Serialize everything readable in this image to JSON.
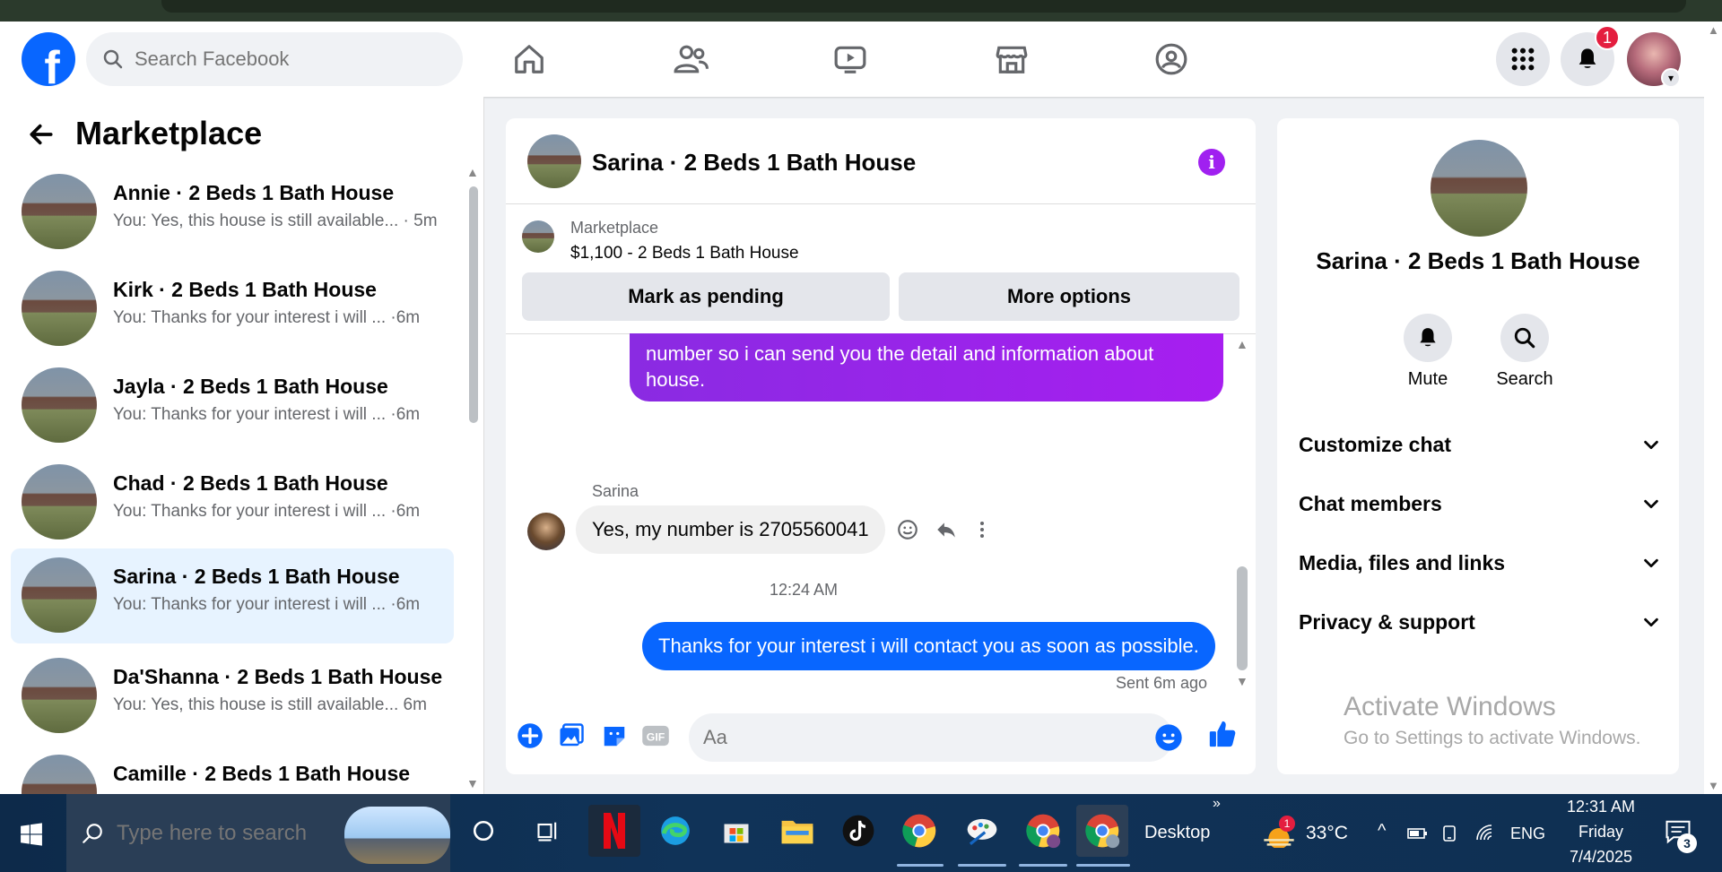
{
  "header": {
    "search_placeholder": "Search Facebook",
    "notification_count": "1"
  },
  "sidebar": {
    "title": "Marketplace",
    "conversations": [
      {
        "name": "Annie · 2 Beds 1 Bath House",
        "preview": "You: Yes, this house is still available... · 5m"
      },
      {
        "name": "Kirk · 2 Beds 1 Bath House",
        "preview": "You: Thanks for your interest i will ... ·6m"
      },
      {
        "name": "Jayla · 2 Beds 1 Bath House",
        "preview": "You: Thanks for your interest i will ... ·6m"
      },
      {
        "name": "Chad · 2 Beds 1 Bath House",
        "preview": "You: Thanks for your interest i will ... ·6m"
      },
      {
        "name": "Sarina · 2 Beds 1 Bath House",
        "preview": "You: Thanks for your interest i will ... ·6m"
      },
      {
        "name": "Da'Shanna · 2 Beds 1 Bath House",
        "preview": "You: Yes, this house is still available... 6m"
      },
      {
        "name": "Camille · 2 Beds 1 Bath House",
        "preview": ""
      }
    ]
  },
  "chat": {
    "title": "Sarina · 2 Beds 1 Bath House",
    "listing_label": "Marketplace",
    "listing_price": "$1,100 - 2 Beds 1 Bath House",
    "mark_pending": "Mark as pending",
    "more_options": "More options",
    "sent_message_1": "number so i can send you the detail and information about house.",
    "sender_name": "Sarina",
    "received_message": "Yes, my number is 2705560041",
    "time_separator": "12:24 AM",
    "sent_message_2": "Thanks for your interest i will contact you as soon as possible.",
    "sent_status": "Sent 6m ago",
    "input_placeholder": "Aa"
  },
  "info": {
    "name": "Sarina · 2 Beds 1 Bath House",
    "mute_label": "Mute",
    "search_label": "Search",
    "sections": [
      "Customize chat",
      "Chat members",
      "Media, files and links",
      "Privacy & support"
    ]
  },
  "watermark": {
    "line1": "Activate Windows",
    "line2": "Go to Settings to activate Windows."
  },
  "taskbar": {
    "search_placeholder": "Type here to search",
    "desktop_label": "Desktop",
    "temperature": "33°C",
    "weather_badge": "1",
    "language": "ENG",
    "time": "12:31 AM",
    "day": "Friday",
    "date": "7/4/2025",
    "notification_count": "3"
  },
  "colors": {
    "fb_blue": "#0866ff",
    "messenger_purple": "#a020f0",
    "badge_red": "#e41e3f"
  }
}
